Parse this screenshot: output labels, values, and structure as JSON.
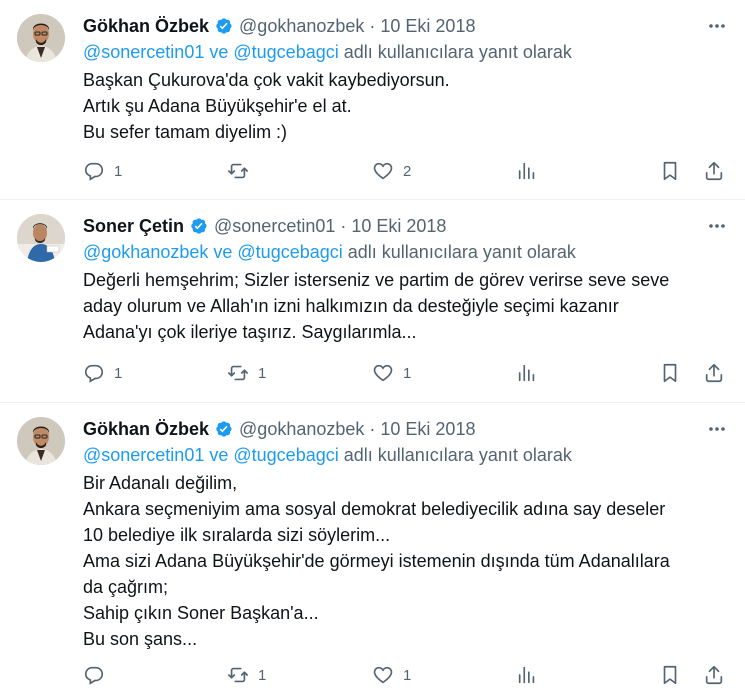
{
  "tweets": [
    {
      "author": "Gökhan Özbek",
      "handle": "@gokhanozbek",
      "date": "10 Eki 2018",
      "reply_to": {
        "user1": "@sonercetin01",
        "connector": "ve",
        "user2": "@tugcebagci",
        "suffix": "adlı kullanıcılara yanıt olarak"
      },
      "lines": [
        "Başkan Çukurova'da çok vakit kaybediyorsun.",
        "Artık şu Adana Büyükşehir'e el at.",
        "Bu sefer tamam diyelim :)"
      ],
      "stats": {
        "replies": "1",
        "retweets": "",
        "likes": "2"
      }
    },
    {
      "author": "Soner Çetin",
      "handle": "@sonercetin01",
      "date": "10 Eki 2018",
      "reply_to": {
        "user1": "@gokhanozbek",
        "connector": "ve",
        "user2": "@tugcebagci",
        "suffix": "adlı kullanıcılara yanıt olarak"
      },
      "lines": [
        "Değerli hemşehrim; Sizler isterseniz ve partim de görev verirse seve seve",
        "aday olurum ve Allah'ın izni halkımızın da desteğiyle seçimi kazanır",
        "Adana'yı çok ileriye taşırız. Saygılarımla..."
      ],
      "stats": {
        "replies": "1",
        "retweets": "1",
        "likes": "1"
      }
    },
    {
      "author": "Gökhan Özbek",
      "handle": "@gokhanozbek",
      "date": "10 Eki 2018",
      "reply_to": {
        "user1": "@sonercetin01",
        "connector": "ve",
        "user2": "@tugcebagci",
        "suffix": "adlı kullanıcılara yanıt olarak"
      },
      "lines": [
        "Bir Adanalı değilim,",
        "Ankara seçmeniyim ama sosyal demokrat belediyecilik adına say deseler",
        "10 belediye ilk sıralarda sizi söylerim...",
        "Ama sizi Adana Büyükşehir'de görmeyi istemenin dışında tüm Adanalılara",
        "da çağrım;",
        "Sahip çıkın Soner Başkan'a...",
        "Bu son şans..."
      ],
      "stats": {
        "replies": "",
        "retweets": "1",
        "likes": "1"
      }
    }
  ],
  "icons": {
    "verified": "verified-badge-icon",
    "more": "more-dots-icon",
    "reply": "reply-icon",
    "retweet": "retweet-icon",
    "like": "heart-icon",
    "views": "views-chart-icon",
    "bookmark": "bookmark-icon",
    "share": "share-icon"
  },
  "colors": {
    "accent": "#1d9bf0",
    "muted": "#536471",
    "text": "#0f1419"
  }
}
